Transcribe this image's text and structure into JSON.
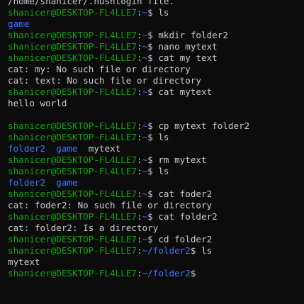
{
  "prompt": {
    "user_host": "shanicer@DESKTOP-FL4LLE7",
    "separator": ":",
    "home": "~",
    "dollar": "$"
  },
  "lines": [
    {
      "type": "out",
      "text": "/home/shanicer/.hushlogin file."
    },
    {
      "type": "prompt",
      "path": "~",
      "cmd": " ls"
    },
    {
      "type": "dirs",
      "items": [
        "game"
      ]
    },
    {
      "type": "prompt",
      "path": "~",
      "cmd": " mkdir folder2"
    },
    {
      "type": "prompt",
      "path": "~",
      "cmd": " nano mytext"
    },
    {
      "type": "prompt",
      "path": "~",
      "cmd": " cat my text"
    },
    {
      "type": "out",
      "text": "cat: my: No such file or directory"
    },
    {
      "type": "out",
      "text": "cat: text: No such file or directory"
    },
    {
      "type": "prompt",
      "path": "~",
      "cmd": " cat mytext"
    },
    {
      "type": "out",
      "text": "hello world"
    },
    {
      "type": "blank"
    },
    {
      "type": "prompt",
      "path": "~",
      "cmd": " cp mytext folder2"
    },
    {
      "type": "prompt",
      "path": "~",
      "cmd": " ls"
    },
    {
      "type": "mixed",
      "dirs": [
        "folder2",
        "game"
      ],
      "files": [
        "mytext"
      ]
    },
    {
      "type": "prompt",
      "path": "~",
      "cmd": " rm mytext"
    },
    {
      "type": "prompt",
      "path": "~",
      "cmd": " ls"
    },
    {
      "type": "dirs",
      "items": [
        "folder2",
        "game"
      ]
    },
    {
      "type": "prompt",
      "path": "~",
      "cmd": " cat foder2"
    },
    {
      "type": "out",
      "text": "cat: foder2: No such file or directory"
    },
    {
      "type": "prompt",
      "path": "~",
      "cmd": " cat folder2"
    },
    {
      "type": "out",
      "text": "cat: folder2: Is a directory"
    },
    {
      "type": "prompt",
      "path": "~",
      "cmd": " cd folder2"
    },
    {
      "type": "prompt",
      "path": "~/folder2",
      "cmd": " ls"
    },
    {
      "type": "out",
      "text": "mytext"
    },
    {
      "type": "prompt",
      "path": "~/folder2",
      "cmd": ""
    }
  ],
  "colors": {
    "background": "#0c0c0c",
    "text": "#cccccc",
    "user_host": "#13a10e",
    "path": "#3b78ff",
    "directory": "#3b78ff"
  }
}
